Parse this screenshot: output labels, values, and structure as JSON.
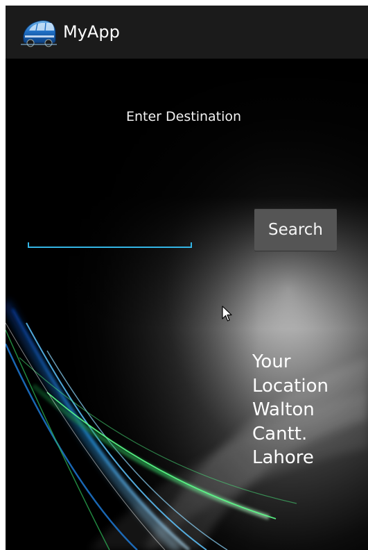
{
  "action_bar": {
    "app_icon": "bus-icon",
    "title": "MyApp"
  },
  "form": {
    "destination_label": "Enter Destination",
    "destination_value": "",
    "search_button_label": "Search"
  },
  "location": {
    "lines": [
      "Your",
      "Location",
      "Walton",
      "Cantt.",
      "Lahore"
    ]
  },
  "colors": {
    "action_bar_bg": "#1b1b1b",
    "input_underline": "#33b5e5",
    "button_bg": "#555555",
    "text": "#ffffff"
  }
}
